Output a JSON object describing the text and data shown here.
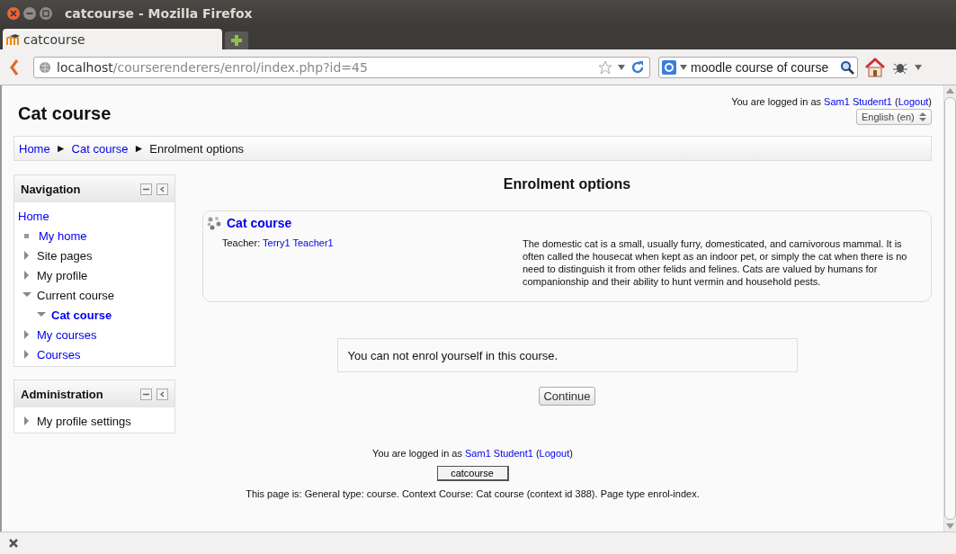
{
  "window": {
    "title": "catcourse - Mozilla Firefox"
  },
  "tabs": [
    {
      "label": "catcourse",
      "selected": true
    }
  ],
  "url": {
    "host": "localhost",
    "path": "/courserenderers/enrol/index.php?id=45"
  },
  "search": {
    "value": "moodle course of course"
  },
  "page": {
    "heading": "Cat course",
    "login_top": {
      "prefix": "You are logged in as ",
      "user": "Sam1 Student1",
      "open": " (",
      "logout": "Logout",
      "close": ")"
    },
    "language": "English (en)",
    "breadcrumb": [
      {
        "label": "Home",
        "link": true
      },
      {
        "label": "Cat course",
        "link": true
      },
      {
        "label": "Enrolment options",
        "link": false
      }
    ],
    "separator": "►"
  },
  "blocks": [
    {
      "title": "Navigation",
      "items": [
        {
          "label": "Home",
          "kind": "root",
          "link": true,
          "selected": false,
          "children": [
            {
              "label": "My home",
              "kind": "leaf",
              "link": true,
              "selected": false
            },
            {
              "label": "Site pages",
              "kind": "branch",
              "link": false,
              "selected": false,
              "expanded": false
            },
            {
              "label": "My profile",
              "kind": "branch",
              "link": false,
              "selected": false,
              "expanded": false
            },
            {
              "label": "Current course",
              "kind": "branch",
              "link": false,
              "selected": false,
              "expanded": true,
              "children": [
                {
                  "label": "Cat course",
                  "kind": "branch",
                  "link": true,
                  "selected": true,
                  "expanded": true
                }
              ]
            },
            {
              "label": "My courses",
              "kind": "branch",
              "link": true,
              "selected": false,
              "expanded": false
            },
            {
              "label": "Courses",
              "kind": "branch",
              "link": true,
              "selected": false,
              "expanded": false
            }
          ]
        }
      ]
    },
    {
      "title": "Administration",
      "items": [
        {
          "label": "My profile settings",
          "kind": "branch",
          "link": false,
          "selected": false,
          "expanded": false
        }
      ]
    }
  ],
  "main": {
    "heading": "Enrolment options",
    "course": {
      "name": "Cat course",
      "teacher_label": "Teacher: ",
      "teacher": "Terry1 Teacher1",
      "summary": "The domestic cat is a small, usually furry, domesticated, and carnivorous mammal. It is often called the housecat when kept as an indoor pet, or simply the cat when there is no need to distinguish it from other felids and felines. Cats are valued by humans for companionship and their ability to hunt vermin and household pests."
    },
    "notice": "You can not enrol yourself in this course.",
    "continue": "Continue"
  },
  "footer": {
    "login": {
      "prefix": "You are logged in as ",
      "user": "Sam1 Student1",
      "open": " (",
      "logout": "Logout",
      "close": ")"
    },
    "home_button": "catcourse",
    "page_info": "This page is: General type: course. Context Course: Cat course (context id 388). Page type enrol-index."
  }
}
